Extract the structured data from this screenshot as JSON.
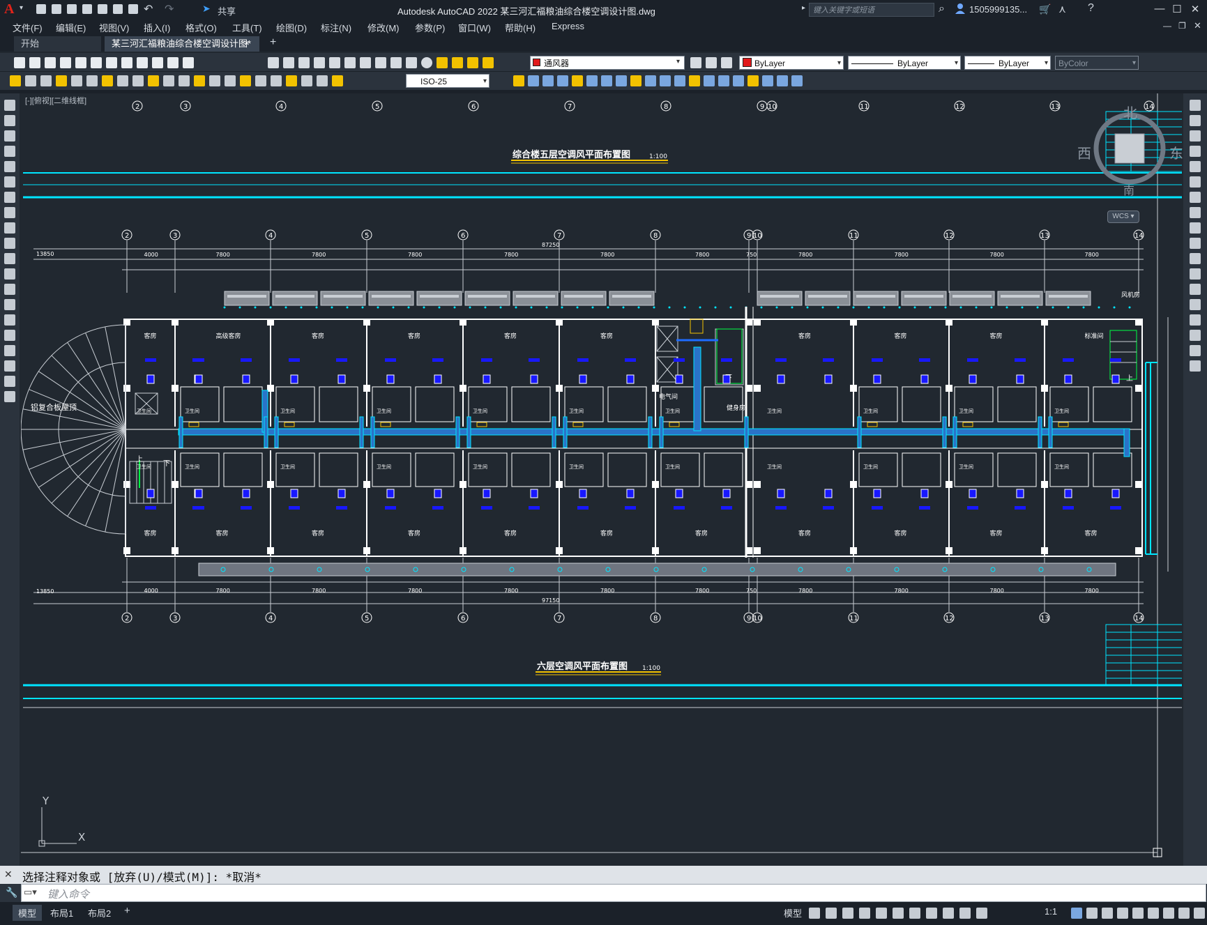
{
  "titlebar": {
    "share": "共享",
    "title": "Autodesk AutoCAD 2022    某三河汇福粮油综合楼空调设计图.dwg",
    "search_placeholder": "键入关键字或短语",
    "user": "1505999135..."
  },
  "menu": [
    "文件(F)",
    "编辑(E)",
    "视图(V)",
    "插入(I)",
    "格式(O)",
    "工具(T)",
    "绘图(D)",
    "标注(N)",
    "修改(M)",
    "参数(P)",
    "窗口(W)",
    "帮助(H)",
    "Express"
  ],
  "tabs": {
    "start": "开始",
    "drawing": "某三河汇福粮油综合楼空调设计图*",
    "close": "×",
    "add": "+"
  },
  "toolbar": {
    "layer": "通风器",
    "layer_color": "#e1191b",
    "color": "ByLayer",
    "linetype": "ByLayer",
    "lineweight": "ByLayer",
    "plotstyle": "ByColor",
    "dimstyle": "ISO-25"
  },
  "viewport": {
    "label": "[-][俯视][二维线框]",
    "viewcube": {
      "north": "北",
      "south": "南",
      "east": "东",
      "west": "西",
      "wcs": "WCS"
    }
  },
  "drawing": {
    "title_upper": "综合楼五层空调风平面布置图",
    "title_lower": "六层空调风平面布置图",
    "scale": "1:100",
    "overall_dim_top": "87250",
    "overall_dim_bottom": "97150",
    "left_dim": "13850",
    "grid_labels": [
      "2",
      "3",
      "4",
      "5",
      "6",
      "7",
      "8",
      "9",
      "10",
      "11",
      "12",
      "13",
      "14"
    ],
    "bay_dims": [
      "4000",
      "7800",
      "7800",
      "7800",
      "7800",
      "7800",
      "7800",
      "750",
      "7800",
      "7800",
      "7800",
      "7800"
    ],
    "room_guest": "客房",
    "room_suite": "高级客房",
    "room_standard": "标准间",
    "room_bath": "卫生间",
    "room_elec": "电气间",
    "room_fitness": "健身房",
    "roof_label": "铝复合板屋顶",
    "stair_up": "上",
    "stair_down": "下",
    "fan_room": "风机房"
  },
  "command": {
    "history": "选择注释对象或 [放弃(U)/模式(M)]: *取消*",
    "placeholder": "键入命令"
  },
  "layouts": [
    "模型",
    "布局1",
    "布局2"
  ],
  "status": {
    "model": "模型",
    "scale": "1:1"
  },
  "colors": {
    "background": "#212830",
    "duct": "#3fa0ff",
    "duct_outline": "#00e5ff",
    "grid_line": "#00e5ff",
    "title_underline": "#f2c200",
    "unit": "#1818ff"
  }
}
